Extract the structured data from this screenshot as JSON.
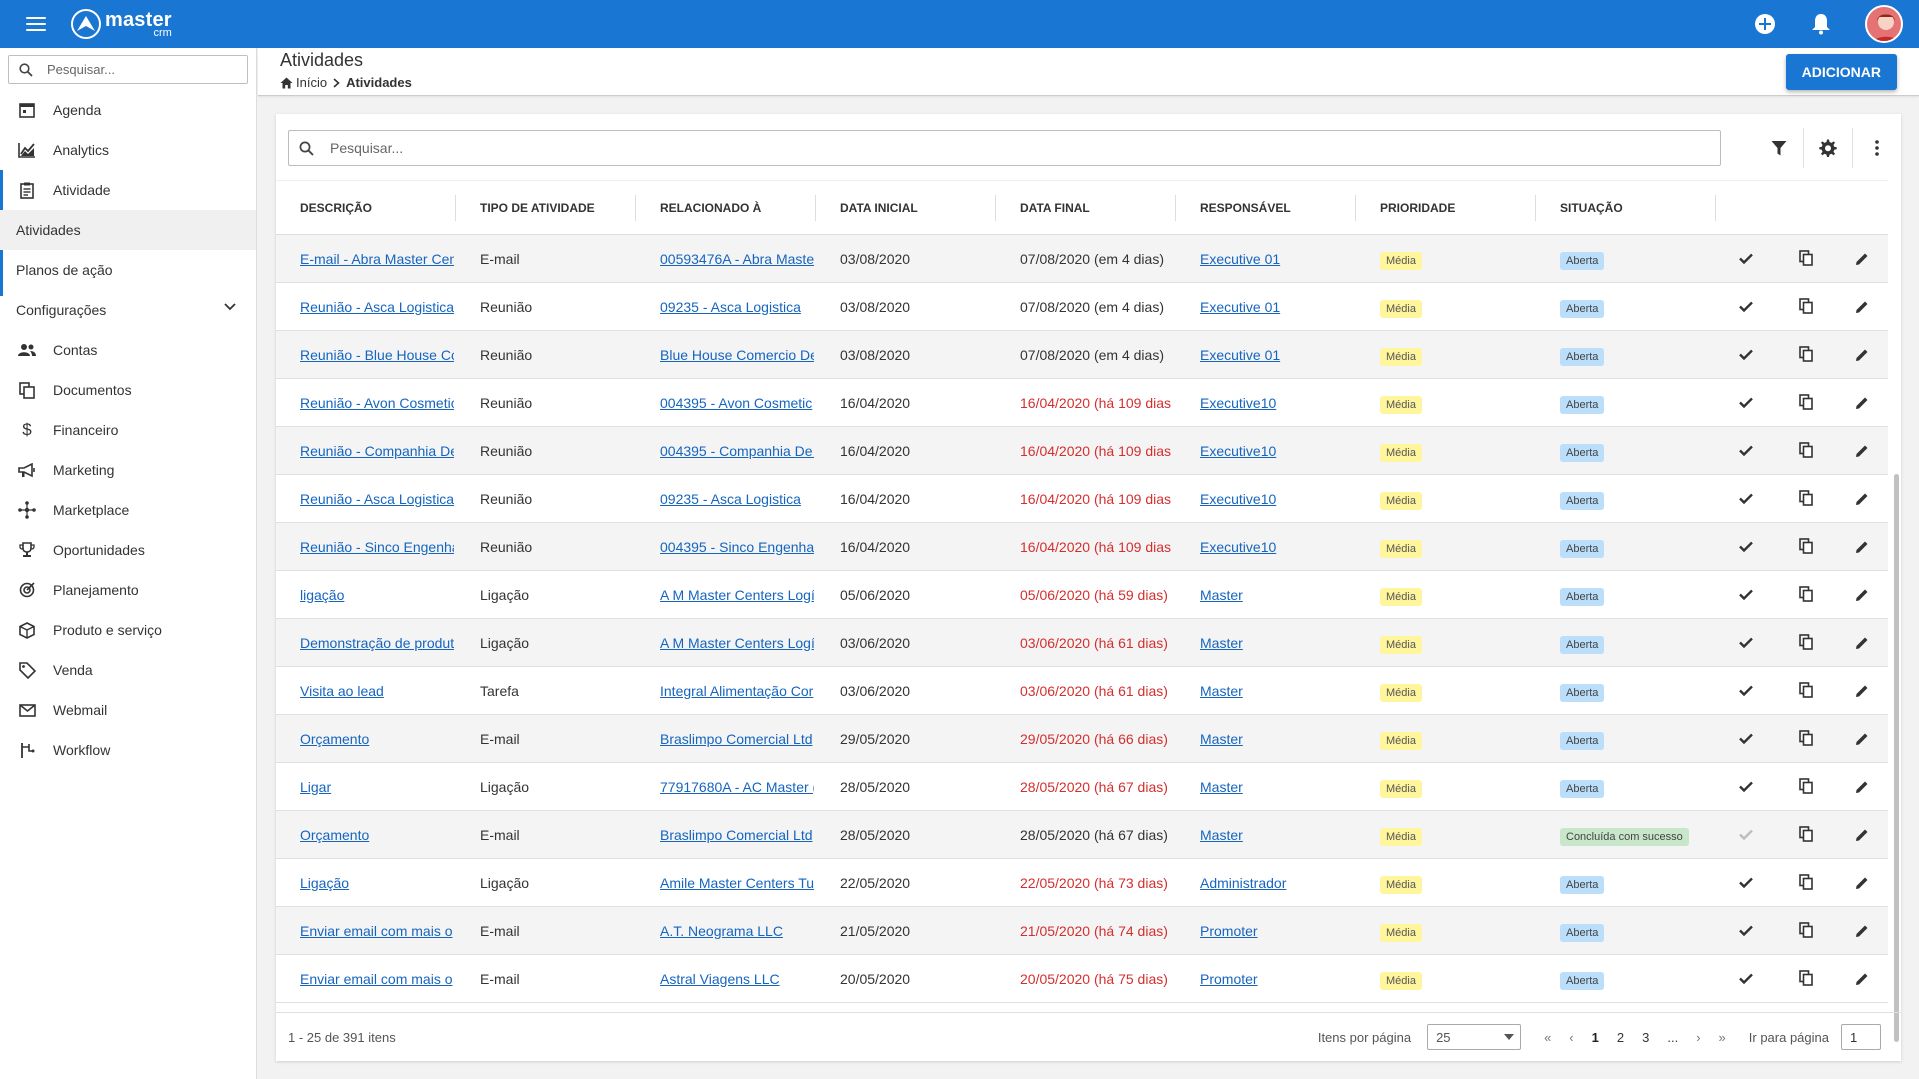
{
  "app": {
    "logo_main": "master",
    "logo_sub": "crm",
    "brand_color": "#1976d2"
  },
  "topbar": {
    "icons": [
      "menu-icon",
      "add-circle-icon",
      "notifications-icon",
      "user-avatar"
    ]
  },
  "sidebar": {
    "search_placeholder": "Pesquisar...",
    "items": [
      {
        "label": "Agenda",
        "icon": "calendar-icon"
      },
      {
        "label": "Analytics",
        "icon": "chart-line-icon"
      },
      {
        "label": "Atividade",
        "icon": "clipboard-icon"
      },
      {
        "label": "Atividades",
        "icon": ""
      },
      {
        "label": "Planos de ação",
        "icon": ""
      },
      {
        "label": "Configurações",
        "icon": "chevron-down-icon"
      },
      {
        "label": "Contas",
        "icon": "people-icon"
      },
      {
        "label": "Documentos",
        "icon": "documents-icon"
      },
      {
        "label": "Financeiro",
        "icon": "dollar-icon"
      },
      {
        "label": "Marketing",
        "icon": "megaphone-icon"
      },
      {
        "label": "Marketplace",
        "icon": "hub-icon"
      },
      {
        "label": "Oportunidades",
        "icon": "trophy-icon"
      },
      {
        "label": "Planejamento",
        "icon": "target-icon"
      },
      {
        "label": "Produto e serviço",
        "icon": "box-icon"
      },
      {
        "label": "Venda",
        "icon": "tag-icon"
      },
      {
        "label": "Webmail",
        "icon": "mail-icon"
      },
      {
        "label": "Workflow",
        "icon": "workflow-icon"
      }
    ]
  },
  "header": {
    "title": "Atividades",
    "breadcrumb_home": "Início",
    "breadcrumb_current": "Atividades",
    "add_button": "ADICIONAR"
  },
  "toolbar": {
    "search_placeholder": "Pesquisar...",
    "icons": [
      "filter-icon",
      "settings-icon",
      "more-vert-icon"
    ]
  },
  "table": {
    "columns": [
      "DESCRIÇÃO",
      "TIPO DE ATIVIDADE",
      "RELACIONADO À",
      "DATA INICIAL",
      "DATA FINAL",
      "RESPONSÁVEL",
      "PRIORIDADE",
      "SITUAÇÃO"
    ],
    "rows": [
      {
        "desc": "E-mail - Abra Master Cen",
        "tipo": "E-mail",
        "rel": "00593476A - Abra Maste",
        "ini": "03/08/2020",
        "fim": "07/08/2020 (em 4 dias)",
        "overdue": false,
        "resp": "Executive 01",
        "prio": "Média",
        "sit": "Aberta",
        "done": false
      },
      {
        "desc": "Reunião - Asca Logistica",
        "tipo": "Reunião",
        "rel": "09235 - Asca Logistica",
        "ini": "03/08/2020",
        "fim": "07/08/2020 (em 4 dias)",
        "overdue": false,
        "resp": "Executive 01",
        "prio": "Média",
        "sit": "Aberta",
        "done": false
      },
      {
        "desc": "Reunião - Blue House Co",
        "tipo": "Reunião",
        "rel": "Blue House Comercio De",
        "ini": "03/08/2020",
        "fim": "07/08/2020 (em 4 dias)",
        "overdue": false,
        "resp": "Executive 01",
        "prio": "Média",
        "sit": "Aberta",
        "done": false
      },
      {
        "desc": "Reunião - Avon Cosmetic",
        "tipo": "Reunião",
        "rel": "004395 - Avon Cosmetic",
        "ini": "16/04/2020",
        "fim": "16/04/2020 (há 109 dias",
        "overdue": true,
        "resp": "Executive10",
        "prio": "Média",
        "sit": "Aberta",
        "done": false
      },
      {
        "desc": "Reunião - Companhia De",
        "tipo": "Reunião",
        "rel": "004395 - Companhia De (",
        "ini": "16/04/2020",
        "fim": "16/04/2020 (há 109 dias",
        "overdue": true,
        "resp": "Executive10",
        "prio": "Média",
        "sit": "Aberta",
        "done": false
      },
      {
        "desc": "Reunião - Asca Logistica",
        "tipo": "Reunião",
        "rel": "09235 - Asca Logistica",
        "ini": "16/04/2020",
        "fim": "16/04/2020 (há 109 dias",
        "overdue": true,
        "resp": "Executive10",
        "prio": "Média",
        "sit": "Aberta",
        "done": false
      },
      {
        "desc": "Reunião - Sinco Engenha",
        "tipo": "Reunião",
        "rel": "004395 - Sinco Engenhar",
        "ini": "16/04/2020",
        "fim": "16/04/2020 (há 109 dias",
        "overdue": true,
        "resp": "Executive10",
        "prio": "Média",
        "sit": "Aberta",
        "done": false
      },
      {
        "desc": "ligação",
        "tipo": "Ligação",
        "rel": "A M Master Centers Logí",
        "ini": "05/06/2020",
        "fim": "05/06/2020 (há 59 dias)",
        "overdue": true,
        "resp": "Master",
        "prio": "Média",
        "sit": "Aberta",
        "done": false
      },
      {
        "desc": "Demonstração de produt",
        "tipo": "Ligação",
        "rel": "A M Master Centers Logí",
        "ini": "03/06/2020",
        "fim": "03/06/2020 (há 61 dias)",
        "overdue": true,
        "resp": "Master",
        "prio": "Média",
        "sit": "Aberta",
        "done": false
      },
      {
        "desc": "Visita ao lead",
        "tipo": "Tarefa",
        "rel": "Integral Alimentação Cor",
        "ini": "03/06/2020",
        "fim": "03/06/2020 (há 61 dias)",
        "overdue": true,
        "resp": "Master",
        "prio": "Média",
        "sit": "Aberta",
        "done": false
      },
      {
        "desc": "Orçamento",
        "tipo": "E-mail",
        "rel": "Braslimpo Comercial Ltd",
        "ini": "29/05/2020",
        "fim": "29/05/2020 (há 66 dias)",
        "overdue": true,
        "resp": "Master",
        "prio": "Média",
        "sit": "Aberta",
        "done": false
      },
      {
        "desc": "Ligar",
        "tipo": "Ligação",
        "rel": "77917680A - AC Master (",
        "ini": "28/05/2020",
        "fim": "28/05/2020 (há 67 dias)",
        "overdue": true,
        "resp": "Master",
        "prio": "Média",
        "sit": "Aberta",
        "done": false
      },
      {
        "desc": "Orçamento",
        "tipo": "E-mail",
        "rel": "Braslimpo Comercial Ltd",
        "ini": "28/05/2020",
        "fim": "28/05/2020 (há 67 dias)",
        "overdue": false,
        "resp": "Master",
        "prio": "Média",
        "sit": "Concluída com sucesso",
        "done": true
      },
      {
        "desc": "Ligação",
        "tipo": "Ligação",
        "rel": "Amile Master Centers Tu",
        "ini": "22/05/2020",
        "fim": "22/05/2020 (há 73 dias)",
        "overdue": true,
        "resp": "Administrador",
        "prio": "Média",
        "sit": "Aberta",
        "done": false
      },
      {
        "desc": "Enviar email com mais o",
        "tipo": "E-mail",
        "rel": "A.T. Neograma LLC",
        "ini": "21/05/2020",
        "fim": "21/05/2020 (há 74 dias)",
        "overdue": true,
        "resp": "Promoter",
        "prio": "Média",
        "sit": "Aberta",
        "done": false
      },
      {
        "desc": "Enviar email com mais o",
        "tipo": "E-mail",
        "rel": "Astral Viagens LLC",
        "ini": "20/05/2020",
        "fim": "20/05/2020 (há 75 dias)",
        "overdue": true,
        "resp": "Promoter",
        "prio": "Média",
        "sit": "Aberta",
        "done": false
      }
    ]
  },
  "footer": {
    "range": "1 - 25 de 391 itens",
    "per_page_label": "Itens por página",
    "per_page_value": "25",
    "pages": [
      "1",
      "2",
      "3",
      "..."
    ],
    "current_page": "1",
    "goto_label": "Ir para página",
    "goto_value": "1"
  }
}
